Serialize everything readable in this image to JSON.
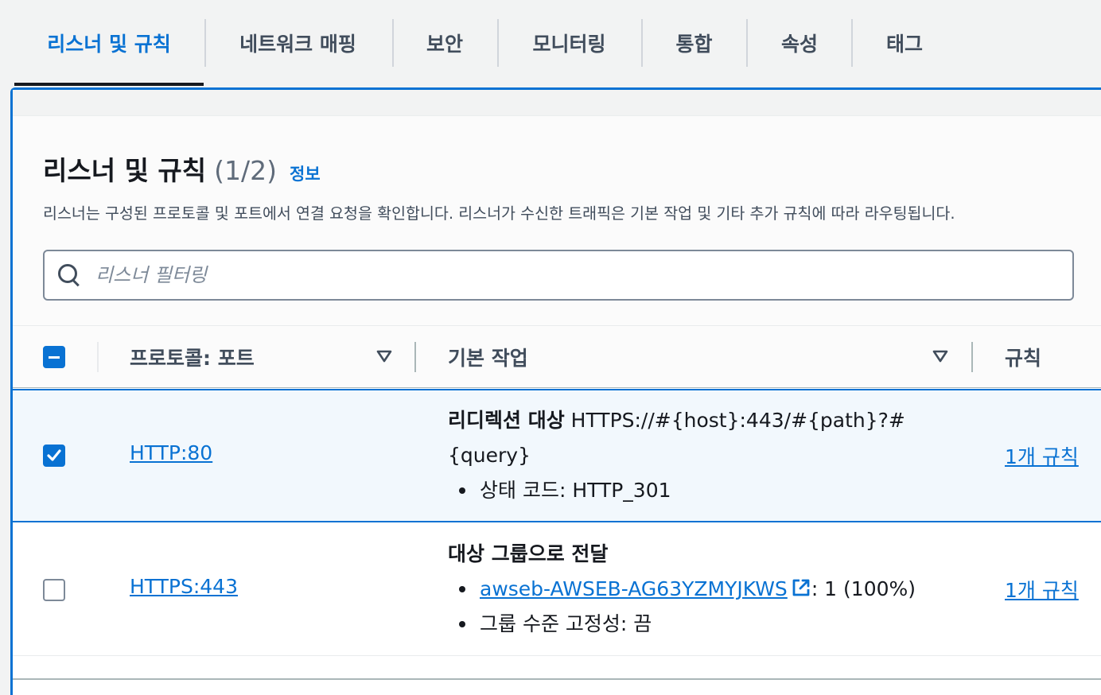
{
  "tabs": [
    {
      "label": "리스너 및 규칙",
      "active": true
    },
    {
      "label": "네트워크 매핑"
    },
    {
      "label": "보안"
    },
    {
      "label": "모니터링"
    },
    {
      "label": "통합"
    },
    {
      "label": "속성"
    },
    {
      "label": "태그"
    }
  ],
  "panel": {
    "title": "리스너 및 규칙",
    "count": "(1/2)",
    "info_link": "정보",
    "description": "리스너는 구성된 프로토콜 및 포트에서 연결 요청을 확인합니다. 리스너가 수신한 트래픽은 기본 작업 및 기타 추가 규칙에 따라 라우팅됩니다.",
    "search_placeholder": "리스너 필터링"
  },
  "table": {
    "columns": [
      "프로토콜: 포트",
      "기본 작업",
      "규칙"
    ],
    "rows": [
      {
        "selected": true,
        "protocol_port": "HTTP:80",
        "action_title": "리디렉션 대상",
        "action_target": " HTTPS://#{host}:443/#{path}?#",
        "action_target_cont": "{query}",
        "bullet1": "상태 코드: HTTP_301",
        "rules": "1개 규칙"
      },
      {
        "selected": false,
        "protocol_port": "HTTPS:443",
        "action_title": "대상 그룹으로 전달",
        "target_group": "awseb-AWSEB-AG63YZMYJKWS",
        "target_group_weight": ": 1 (100%)",
        "bullet2": "그룹 수준 고정성: 끔",
        "rules": "1개 규칙"
      }
    ]
  },
  "colors": {
    "accent": "#0972d3",
    "text": "#16191f",
    "muted": "#414d5c"
  }
}
